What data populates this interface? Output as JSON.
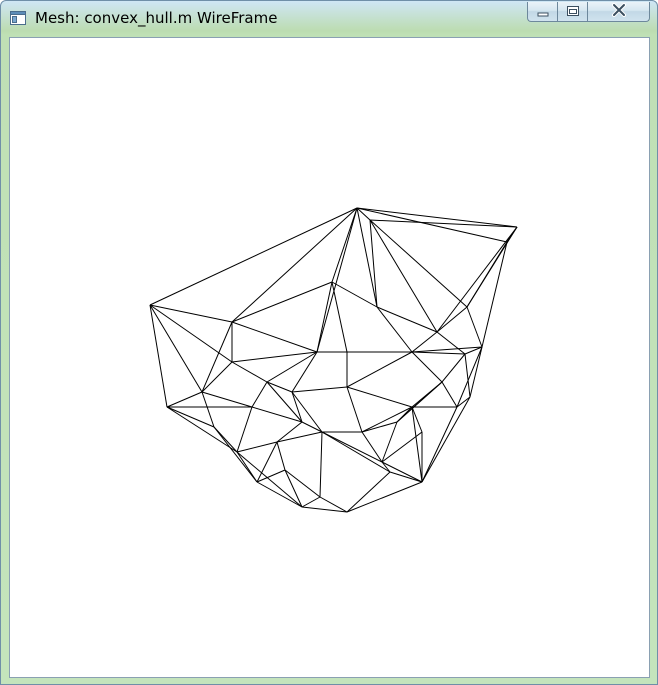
{
  "window": {
    "title": "Mesh: convex_hull.m WireFrame",
    "icons": {
      "app": "app-window-icon",
      "minimize": "minimize-icon",
      "maximize": "maximize-icon",
      "close": "close-icon"
    }
  },
  "viewport": {
    "render_mode": "wireframe",
    "background_color": "#ffffff",
    "line_color": "#000000"
  }
}
